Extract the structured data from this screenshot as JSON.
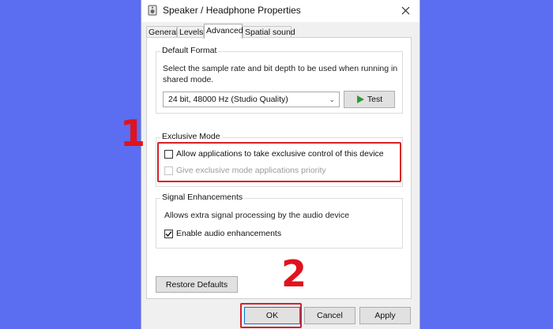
{
  "window": {
    "title": "Speaker / Headphone Properties",
    "close_glyph": "✕"
  },
  "tabs": [
    {
      "label": "General",
      "active": false
    },
    {
      "label": "Levels",
      "active": false
    },
    {
      "label": "Advanced",
      "active": true
    },
    {
      "label": "Spatial sound",
      "active": false
    }
  ],
  "default_format": {
    "title": "Default Format",
    "description": "Select the sample rate and bit depth to be used when running in shared mode.",
    "selected_value": "24 bit, 48000 Hz (Studio Quality)",
    "dropdown_arrow": "⌄",
    "test_label": "Test",
    "test_icon_color": "#2f9b2f"
  },
  "exclusive_mode": {
    "title": "Exclusive Mode",
    "allow_exclusive_label": "Allow applications to take exclusive control of this device",
    "allow_exclusive_checked": false,
    "priority_label": "Give exclusive mode applications priority",
    "priority_checked": false,
    "priority_disabled": true
  },
  "signal_enhancements": {
    "title": "Signal Enhancements",
    "description": "Allows extra signal processing by the audio device",
    "enable_label": "Enable audio enhancements",
    "enable_checked": true
  },
  "restore_defaults_label": "Restore Defaults",
  "footer": {
    "ok_label": "OK",
    "cancel_label": "Cancel",
    "apply_label": "Apply"
  },
  "annotations": {
    "step1": "1",
    "step2": "2",
    "color": "#e0131d"
  },
  "colors": {
    "background": "#5b6df0",
    "highlight": "#d81e28"
  }
}
